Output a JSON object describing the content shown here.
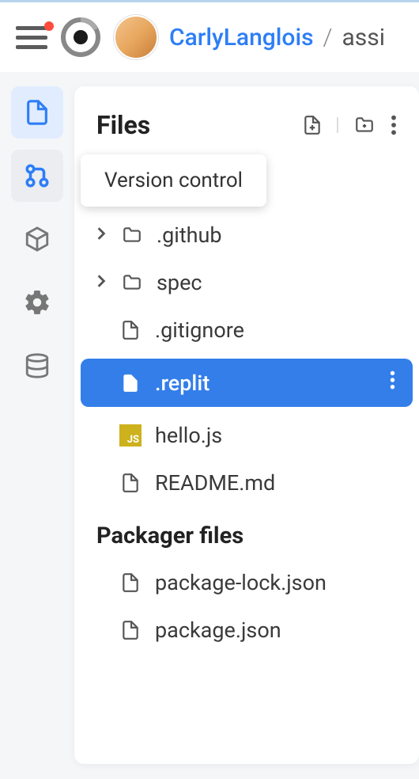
{
  "header": {
    "user": "CarlyLanglois",
    "separator": "/",
    "project": "assi"
  },
  "panel": {
    "title": "Files",
    "tooltip": "Version control"
  },
  "files": [
    {
      "name": ".github",
      "type": "folder",
      "expandable": true
    },
    {
      "name": "spec",
      "type": "folder",
      "expandable": true
    },
    {
      "name": ".gitignore",
      "type": "file"
    },
    {
      "name": ".replit",
      "type": "file",
      "selected": true
    },
    {
      "name": "hello.js",
      "type": "js"
    },
    {
      "name": "README.md",
      "type": "file"
    }
  ],
  "section": {
    "title": "Packager files"
  },
  "packager_files": [
    {
      "name": "package-lock.json",
      "type": "file"
    },
    {
      "name": "package.json",
      "type": "file"
    }
  ],
  "sidebar": {
    "items": [
      "files",
      "version-control",
      "packages",
      "settings",
      "database"
    ]
  }
}
